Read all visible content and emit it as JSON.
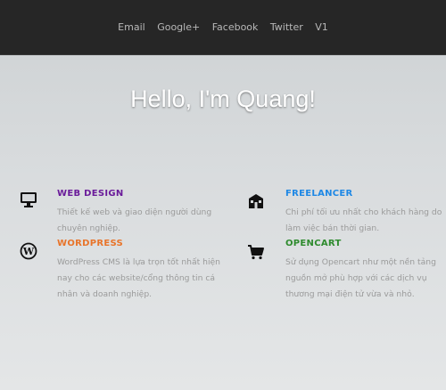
{
  "nav": {
    "items": [
      "Email",
      "Google+",
      "Facebook",
      "Twitter",
      "V1"
    ]
  },
  "hero": {
    "title": "Hello, I'm Quang!"
  },
  "features": [
    {
      "icon": "monitor-icon",
      "title": "WEB DESIGN",
      "color": "#6a1b9a",
      "lines": [
        "Thiết kế web và giao diện người dùng",
        "chuyên nghiệp."
      ]
    },
    {
      "icon": "building-icon",
      "title": "FREELANCER",
      "color": "#1e88e5",
      "lines": [
        "Chi phí tối ưu nhất cho khách hàng do",
        "làm việc bán thời gian."
      ]
    },
    {
      "icon": "wordpress-icon",
      "title": "WORDPRESS",
      "color": "#e8742a",
      "lines": [
        "WordPress CMS là lựa trọn tốt nhất hiện",
        "nay cho các website/cổng thông tin cá",
        "nhân và doanh nghiệp."
      ]
    },
    {
      "icon": "cart-icon",
      "title": "OPENCART",
      "color": "#2e8b2e",
      "lines": [
        "Sử dụng Opencart như một nền tảng",
        "nguồn mở phù hợp với các dịch vụ",
        "thương mại điện tử vừa và nhỏ."
      ]
    }
  ]
}
